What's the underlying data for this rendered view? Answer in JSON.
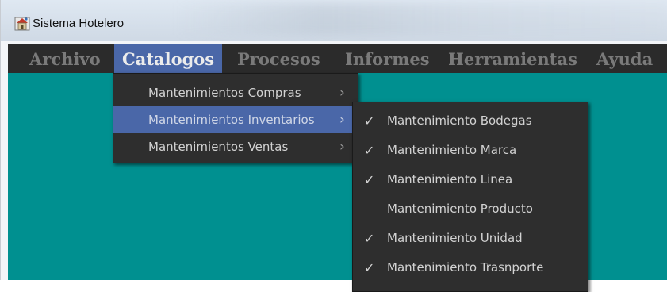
{
  "window": {
    "title": "Sistema Hotelero"
  },
  "menubar": {
    "items": [
      {
        "label": "Archivo"
      },
      {
        "label": "Catalogos"
      },
      {
        "label": "Procesos"
      },
      {
        "label": "Informes"
      },
      {
        "label": "Herramientas"
      },
      {
        "label": "Ayuda"
      }
    ],
    "active": "Catalogos"
  },
  "catalogos_menu": {
    "items": [
      {
        "label": "Mantenimientos Compras",
        "has_submenu": true
      },
      {
        "label": "Mantenimientos Inventarios",
        "has_submenu": true,
        "selected": true
      },
      {
        "label": "Mantenimientos Ventas",
        "has_submenu": true
      }
    ]
  },
  "inventarios_submenu": {
    "items": [
      {
        "label": "Mantenimiento Bodegas",
        "checked": true
      },
      {
        "label": "Mantenimiento Marca",
        "checked": true
      },
      {
        "label": "Mantenimiento Linea",
        "checked": true
      },
      {
        "label": "Mantenimiento Producto",
        "checked": false
      },
      {
        "label": "Mantenimiento Unidad",
        "checked": true
      },
      {
        "label": "Mantenimiento Trasnporte",
        "checked": true
      }
    ]
  },
  "glyphs": {
    "check": "✓",
    "submenu_arrow": "›"
  },
  "colors": {
    "content_bg": "#009090",
    "menubar_bg": "#2b2b2b",
    "active_highlight": "#4a67a8",
    "menu_text": "#7a7a7a"
  }
}
